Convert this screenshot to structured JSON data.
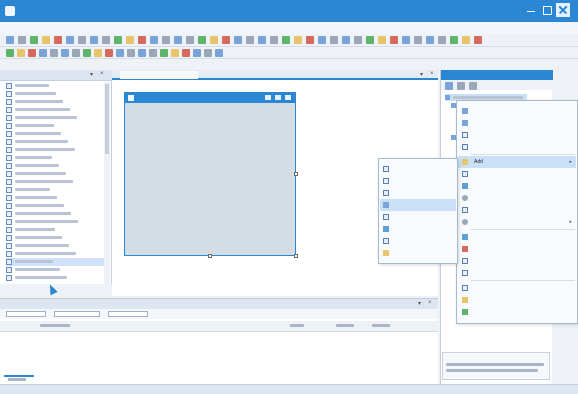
{
  "title_bar": {
    "title": ""
  },
  "menubar": {
    "items": [
      "",
      "",
      "",
      "",
      "",
      "",
      "",
      "",
      "",
      "",
      "",
      ""
    ]
  },
  "toolbox": {
    "title": "",
    "rows": 25,
    "selected_row": 22,
    "footer": ""
  },
  "document": {
    "active_tab": "",
    "second_tab": "",
    "form_title": ""
  },
  "error_list": {
    "title": "",
    "filters": [
      "",
      "",
      ""
    ],
    "columns": [
      "",
      "",
      "",
      ""
    ],
    "tab": ""
  },
  "solution_explorer": {
    "title": "",
    "properties_title": "",
    "properties_description": ""
  },
  "context_menu": {
    "items": [
      {
        "label": "",
        "icon": "build-icon"
      },
      {
        "label": "",
        "icon": "rebuild-icon"
      },
      {
        "label": "",
        "icon": ""
      },
      {
        "label": "",
        "icon": ""
      },
      {
        "label": "Add",
        "icon": "",
        "submenu": true,
        "highlighted": true
      },
      {
        "label": "",
        "icon": ""
      },
      {
        "label": "",
        "icon": ""
      },
      {
        "label": "",
        "icon": ""
      },
      {
        "label": "",
        "icon": ""
      },
      {
        "label": "",
        "icon": "",
        "submenu": true
      },
      {
        "label": "",
        "icon": ""
      },
      {
        "label": "",
        "icon": "cut-icon"
      },
      {
        "label": "",
        "icon": ""
      },
      {
        "label": "",
        "icon": ""
      },
      {
        "label": "",
        "icon": ""
      },
      {
        "label": "",
        "icon": ""
      },
      {
        "label": "",
        "icon": ""
      }
    ]
  },
  "add_submenu": {
    "items": [
      {
        "label": "",
        "icon": ""
      },
      {
        "label": "",
        "icon": ""
      },
      {
        "label": "",
        "icon": ""
      },
      {
        "label": "",
        "icon": "",
        "highlighted": true
      },
      {
        "label": "",
        "icon": ""
      },
      {
        "label": "",
        "icon": ""
      },
      {
        "label": "",
        "icon": ""
      },
      {
        "label": "",
        "icon": ""
      }
    ]
  },
  "colors": {
    "accent": "#2b87d3",
    "highlight": "#c9e0f7",
    "form_body": "#d4dde5"
  }
}
